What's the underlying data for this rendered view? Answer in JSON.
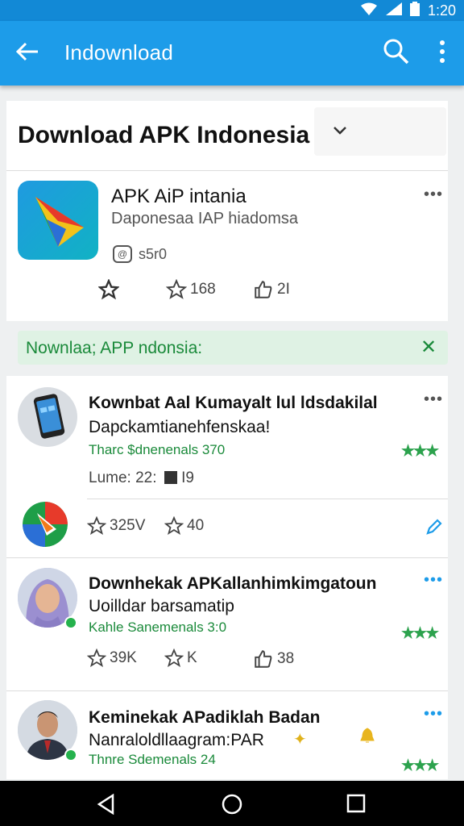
{
  "status_bar": {
    "time": "1:20"
  },
  "app_bar": {
    "title": "Indownload"
  },
  "header": {
    "title": "Download APK Indonesia"
  },
  "app": {
    "name": "APK AiP intania",
    "subtitle": "Daponesaa IAP hiadomsa",
    "size": "s5r0",
    "stat_1": "168",
    "stat_2": "2I"
  },
  "banner": {
    "text": "Nownlaa; APP ndonsia:"
  },
  "posts": [
    {
      "title": "Kownbat Aal Kumayalt lul ldsdakilal",
      "line2": "Dapckamtianehfenskaa!",
      "green": "Tharc $dnenenals 370",
      "meta_label": "Lume: 22:",
      "meta_value": "I9",
      "stat_1": "325V",
      "stat_2": "40"
    },
    {
      "title": "Downhekak APKallanhimkimgatoun",
      "line2": "Uoilldar barsamatip",
      "green": "Kahle Sanemenals 3:0",
      "stat_1": "39K",
      "stat_2": "K",
      "stat_3": "38"
    },
    {
      "title": "Keminekak APadiklah Badan",
      "line2": "Nanraloldllaagram:PAR",
      "green": "Thnre Sdemenals 24"
    }
  ],
  "colors": {
    "primary": "#1d9ce9",
    "green": "#1a8a3a"
  }
}
